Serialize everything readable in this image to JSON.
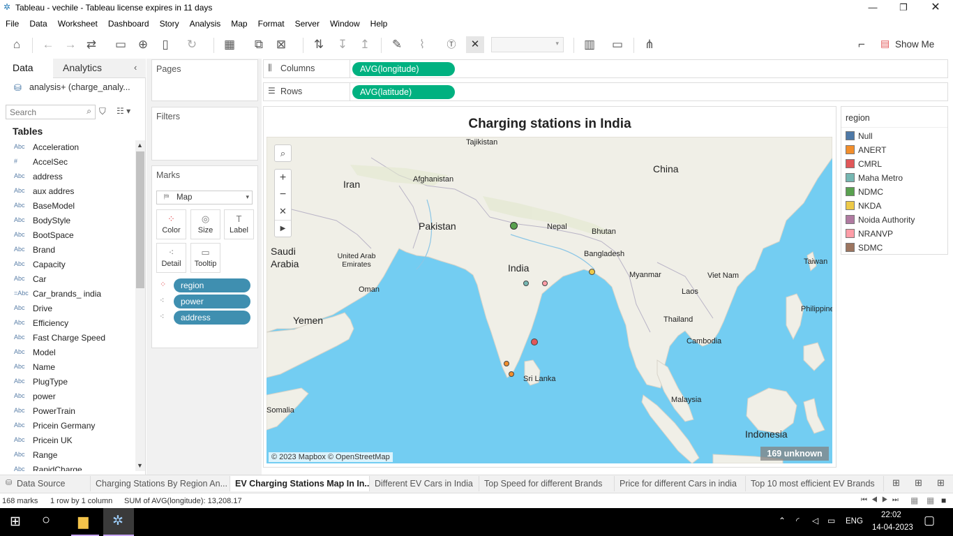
{
  "window": {
    "title": "Tableau - vechile - Tableau license expires in 11 days"
  },
  "menu": [
    "File",
    "Data",
    "Worksheet",
    "Dashboard",
    "Story",
    "Analysis",
    "Map",
    "Format",
    "Server",
    "Window",
    "Help"
  ],
  "toolbar": {
    "show_me": "Show Me"
  },
  "left_panel": {
    "tabs": {
      "data": "Data",
      "analytics": "Analytics"
    },
    "datasource": "analysis+ (charge_analy...",
    "search_placeholder": "Search",
    "tables_heading": "Tables",
    "fields": [
      {
        "type": "Abc",
        "name": "Acceleration"
      },
      {
        "type": "#",
        "name": "AccelSec"
      },
      {
        "type": "Abc",
        "name": "address"
      },
      {
        "type": "Abc",
        "name": "aux addres"
      },
      {
        "type": "Abc",
        "name": "BaseModel"
      },
      {
        "type": "Abc",
        "name": "BodyStyle"
      },
      {
        "type": "Abc",
        "name": "BootSpace"
      },
      {
        "type": "Abc",
        "name": "Brand"
      },
      {
        "type": "Abc",
        "name": "Capacity"
      },
      {
        "type": "Abc",
        "name": "Car"
      },
      {
        "type": "=Abc",
        "name": "Car_brands_ india"
      },
      {
        "type": "Abc",
        "name": "Drive"
      },
      {
        "type": "Abc",
        "name": "Efficiency"
      },
      {
        "type": "Abc",
        "name": "Fast Charge Speed"
      },
      {
        "type": "Abc",
        "name": "Model"
      },
      {
        "type": "Abc",
        "name": "Name"
      },
      {
        "type": "Abc",
        "name": "PlugType"
      },
      {
        "type": "Abc",
        "name": "power"
      },
      {
        "type": "Abc",
        "name": "PowerTrain"
      },
      {
        "type": "Abc",
        "name": "Pricein Germany"
      },
      {
        "type": "Abc",
        "name": "Pricein UK"
      },
      {
        "type": "Abc",
        "name": "Range"
      },
      {
        "type": "Abc",
        "name": "RapidCharge"
      }
    ]
  },
  "cards": {
    "pages": "Pages",
    "filters": "Filters",
    "marks": "Marks",
    "mark_type": "Map",
    "mark_buttons": {
      "color": "Color",
      "size": "Size",
      "label": "Label",
      "detail": "Detail",
      "tooltip": "Tooltip"
    },
    "mark_pills": [
      "region",
      "power",
      "address"
    ]
  },
  "shelves": {
    "columns_label": "Columns",
    "columns_pill": "AVG(longitude)",
    "rows_label": "Rows",
    "rows_pill": "AVG(latitude)"
  },
  "view": {
    "title": "Charging stations in India",
    "attribution": "© 2023 Mapbox © OpenStreetMap",
    "unknown_badge": "169 unknown",
    "map_labels": [
      "Tajikistan",
      "Iran",
      "Afghanistan",
      "China",
      "Pakistan",
      "Nepal",
      "Bhutan",
      "Saudi Arabia",
      "United Arab Emirates",
      "India",
      "Bangladesh",
      "Myanmar",
      "Taiwan",
      "Oman",
      "Viet Nam",
      "Laos",
      "Yemen",
      "Thailand",
      "Philippines",
      "Cambodia",
      "Sri Lanka",
      "Somalia",
      "Malaysia",
      "Indonesia"
    ],
    "colors": {
      "water": "#73cdf2",
      "land": "#f0efe7"
    }
  },
  "legend": {
    "title": "region",
    "items": [
      {
        "label": "Null",
        "color": "#4e79a7"
      },
      {
        "label": "ANERT",
        "color": "#f28e2b"
      },
      {
        "label": "CMRL",
        "color": "#e15759"
      },
      {
        "label": "Maha Metro",
        "color": "#76b7b2"
      },
      {
        "label": "NDMC",
        "color": "#59a14f"
      },
      {
        "label": "NKDA",
        "color": "#edc948"
      },
      {
        "label": "Noida Authority",
        "color": "#b07aa1"
      },
      {
        "label": "NRANVP",
        "color": "#ff9da7"
      },
      {
        "label": "SDMC",
        "color": "#9c755f"
      }
    ]
  },
  "sheet_tabs": [
    {
      "label": "Data Source",
      "active": false
    },
    {
      "label": "Charging Stations By Region An...",
      "active": false
    },
    {
      "label": "EV Charging Stations Map In In...",
      "active": true
    },
    {
      "label": "Different EV Cars in India",
      "active": false
    },
    {
      "label": "Top Speed for different Brands",
      "active": false
    },
    {
      "label": "Price for different Cars in india",
      "active": false
    },
    {
      "label": "Top 10 most efficient EV Brands",
      "active": false
    }
  ],
  "status_bar": {
    "marks": "168 marks",
    "rows": "1 row by 1 column",
    "sum": "SUM of AVG(longitude): 13,208.17"
  },
  "taskbar": {
    "lang": "ENG",
    "time": "22:02",
    "date": "14-04-2023"
  }
}
